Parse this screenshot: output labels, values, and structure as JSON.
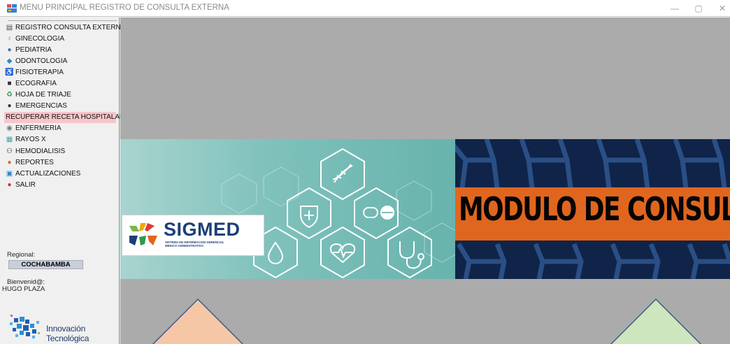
{
  "window": {
    "title": "MENU PRINCIPAL REGISTRO DE CONSULTA EXTERNA",
    "controls": {
      "minimize": "—",
      "maximize": "▢",
      "close": "✕"
    }
  },
  "sidebar": {
    "items": [
      {
        "label": "REGISTRO CONSULTA EXTERNA",
        "icon": "register-icon",
        "color": "#4a4a4a"
      },
      {
        "label": "GINECOLOGIA",
        "icon": "female-symbol-icon",
        "color": "#e07a1a"
      },
      {
        "label": "PEDIATRIA",
        "icon": "baby-icon",
        "color": "#3e6fb5"
      },
      {
        "label": "ODONTOLOGIA",
        "icon": "tooth-icon",
        "color": "#2d86c9"
      },
      {
        "label": "FISIOTERAPIA",
        "icon": "wheelchair-icon",
        "color": "#6ba0d6"
      },
      {
        "label": "ECOGRAFIA",
        "icon": "ultrasound-icon",
        "color": "#333333"
      },
      {
        "label": "HOJA DE TRIAJE",
        "icon": "recycle-icon",
        "color": "#2e9a4a"
      },
      {
        "label": "EMERGENCIAS",
        "icon": "ambulance-icon",
        "color": "#333333"
      },
      {
        "label": "RECUPERAR RECETA HOSPITALARIA",
        "icon": "",
        "color": "#f7c6cc",
        "selected": true
      },
      {
        "label": "ENFERMERIA",
        "icon": "nurse-icon",
        "color": "#777777"
      },
      {
        "label": "RAYOS X",
        "icon": "xray-icon",
        "color": "#4da3a3"
      },
      {
        "label": "HEMODIALISIS",
        "icon": "people-icon",
        "color": "#222222"
      },
      {
        "label": "REPORTES",
        "icon": "report-icon",
        "color": "#e0661f"
      },
      {
        "label": "ACTUALIZACIONES",
        "icon": "update-icon",
        "color": "#2b84c8"
      },
      {
        "label": "SALIR",
        "icon": "exit-icon",
        "color": "#c0392b"
      }
    ],
    "regional_label": "Regional:",
    "regional_value": "COCHABAMBA",
    "welcome_label": "Bienvenid@:",
    "user_name": "HUGO PLAZA",
    "innovation_logo_text": "Innovación Tecnológica"
  },
  "banner": {
    "sigmed_title": "SIGMED",
    "sigmed_subtitle_line1": "SISTEMA DE INFORMACION GERENCIAL",
    "sigmed_subtitle_line2": "MEDICO ADMINISTRATIVO",
    "module_title": "MODULO DE CONSULTA"
  },
  "colors": {
    "main_bg": "#ababab",
    "banner_teal": "#7fc1bb",
    "banner_navy": "#0f2448",
    "banner_orange": "#e0661f",
    "selected_item": "#f7c6cc",
    "triangle_left": "#f6c7a7",
    "triangle_right": "#cde6bd"
  }
}
